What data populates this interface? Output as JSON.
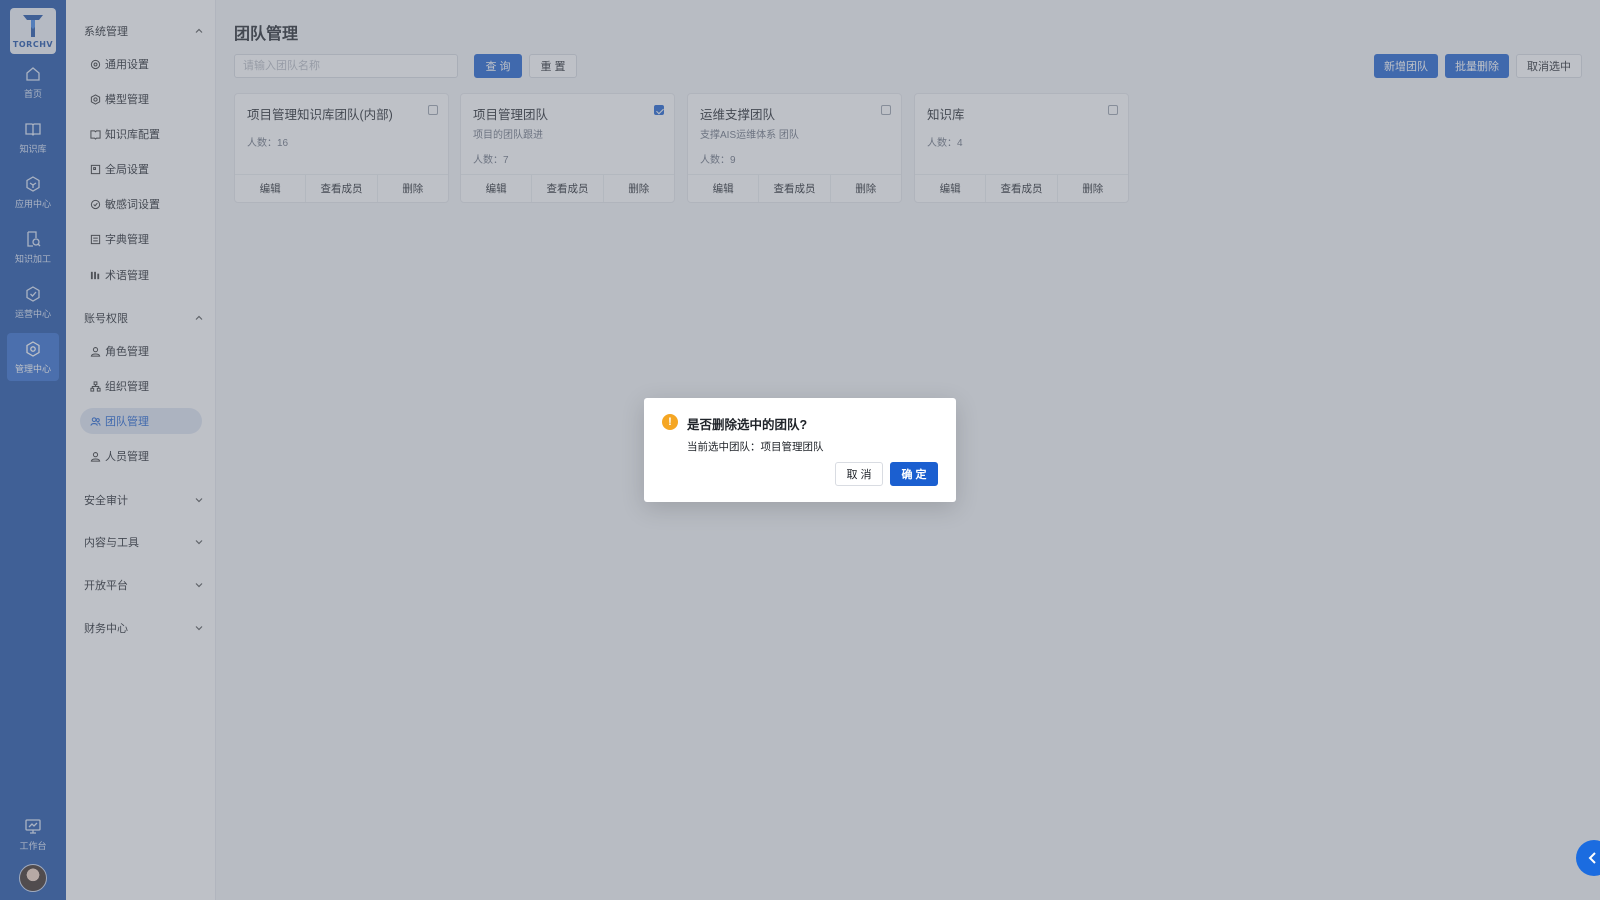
{
  "brand": {
    "name": "TORCHV"
  },
  "rail": {
    "items": [
      {
        "label": "首页",
        "icon": "home-icon"
      },
      {
        "label": "知识库",
        "icon": "book-icon"
      },
      {
        "label": "应用中心",
        "icon": "hexagon-icon"
      },
      {
        "label": "知识加工",
        "icon": "doc-edit-icon"
      },
      {
        "label": "运营中心",
        "icon": "hexagon-check-icon"
      },
      {
        "label": "管理中心",
        "icon": "settings-hex-icon",
        "active": true
      }
    ],
    "workbench": {
      "label": "工作台",
      "icon": "monitor-icon"
    }
  },
  "menu": {
    "groups": [
      {
        "label": "系统管理",
        "expanded": true,
        "items": [
          {
            "label": "通用设置",
            "icon": "gear-icon"
          },
          {
            "label": "模型管理",
            "icon": "model-icon"
          },
          {
            "label": "知识库配置",
            "icon": "book-icon"
          },
          {
            "label": "全局设置",
            "icon": "window-icon"
          },
          {
            "label": "敏感词设置",
            "icon": "shield-icon"
          },
          {
            "label": "字典管理",
            "icon": "list-icon"
          },
          {
            "label": "术语管理",
            "icon": "bars-icon"
          }
        ]
      },
      {
        "label": "账号权限",
        "expanded": true,
        "items": [
          {
            "label": "角色管理",
            "icon": "user-icon"
          },
          {
            "label": "组织管理",
            "icon": "org-icon"
          },
          {
            "label": "团队管理",
            "icon": "team-icon",
            "active": true
          },
          {
            "label": "人员管理",
            "icon": "person-icon"
          }
        ]
      },
      {
        "label": "安全审计",
        "expanded": false
      },
      {
        "label": "内容与工具",
        "expanded": false
      },
      {
        "label": "开放平台",
        "expanded": false
      },
      {
        "label": "财务中心",
        "expanded": false
      }
    ]
  },
  "page": {
    "title": "团队管理",
    "search_placeholder": "请输入团队名称",
    "query_label": "查 询",
    "reset_label": "重 置",
    "add_label": "新增团队",
    "batch_delete_label": "批量删除",
    "cancel_select_label": "取消选中"
  },
  "cards": [
    {
      "title": "项目管理知识库团队(内部)",
      "desc": "",
      "count": "人数：16",
      "checked": false
    },
    {
      "title": "项目管理团队",
      "desc": "项目的团队跟进",
      "count": "人数：7",
      "checked": true
    },
    {
      "title": "运维支撑团队",
      "desc": "支撑AIS运维体系 团队",
      "count": "人数：9",
      "checked": false
    },
    {
      "title": "知识库",
      "desc": "",
      "count": "人数：4",
      "checked": false
    }
  ],
  "card_actions": {
    "edit": "编辑",
    "members": "查看成员",
    "delete": "删除"
  },
  "modal": {
    "title": "是否删除选中的团队?",
    "body": "当前选中团队：项目管理团队",
    "cancel": "取 消",
    "confirm": "确 定"
  },
  "colors": {
    "primary": "#1b5fd0",
    "rail": "#1b4fa6",
    "warning": "#f5a623"
  }
}
